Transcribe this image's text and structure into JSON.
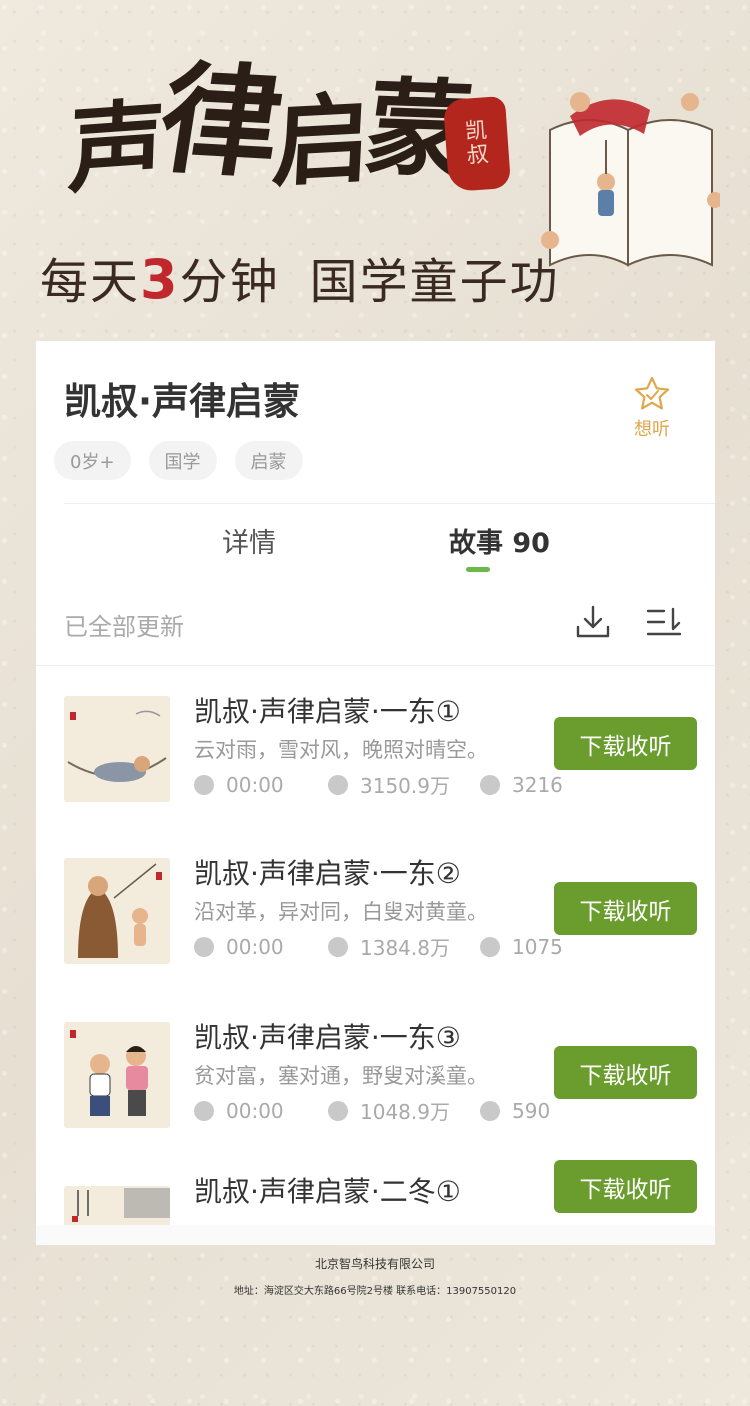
{
  "banner": {
    "title_chars": [
      "声",
      "律",
      "启",
      "蒙"
    ],
    "seal_text": [
      "凯",
      "叔"
    ],
    "slogan_pre": "每天",
    "slogan_number": "3",
    "slogan_post": "分钟",
    "slogan_second": "国学童子功",
    "accent_color": "#c0282d"
  },
  "album": {
    "title": "凯叔·声律启蒙",
    "favorite_label": "想听",
    "tags": [
      "0岁+",
      "国学",
      "启蒙"
    ]
  },
  "tabs": {
    "detail": "详情",
    "stories": "故事 90",
    "active": "stories",
    "active_color": "#6db84a"
  },
  "list_header": {
    "status": "已全部更新",
    "download_icon": "download-icon",
    "sort_icon": "sort-icon"
  },
  "episodes": [
    {
      "title": "凯叔·声律启蒙·一东①",
      "desc": "云对雨，雪对风，晚照对晴空。",
      "duration": "00:00",
      "plays": "3150.9万",
      "comments": "3216",
      "button": "下载收听"
    },
    {
      "title": "凯叔·声律启蒙·一东②",
      "desc": "沿对革，异对同，白叟对黄童。",
      "duration": "00:00",
      "plays": "1384.8万",
      "comments": "1075",
      "button": "下载收听"
    },
    {
      "title": "凯叔·声律启蒙·一东③",
      "desc": "贫对富，塞对通，野叟对溪童。",
      "duration": "00:00",
      "plays": "1048.9万",
      "comments": "590",
      "button": "下载收听"
    },
    {
      "title": "凯叔·声律启蒙·二冬①",
      "button": "下载收听"
    }
  ],
  "button_color": "#6a9d2e",
  "footer": {
    "company": "北京智鸟科技有限公司",
    "address": "地址：海淀区交大东路66号院2号楼  联系电话：13907550120"
  }
}
